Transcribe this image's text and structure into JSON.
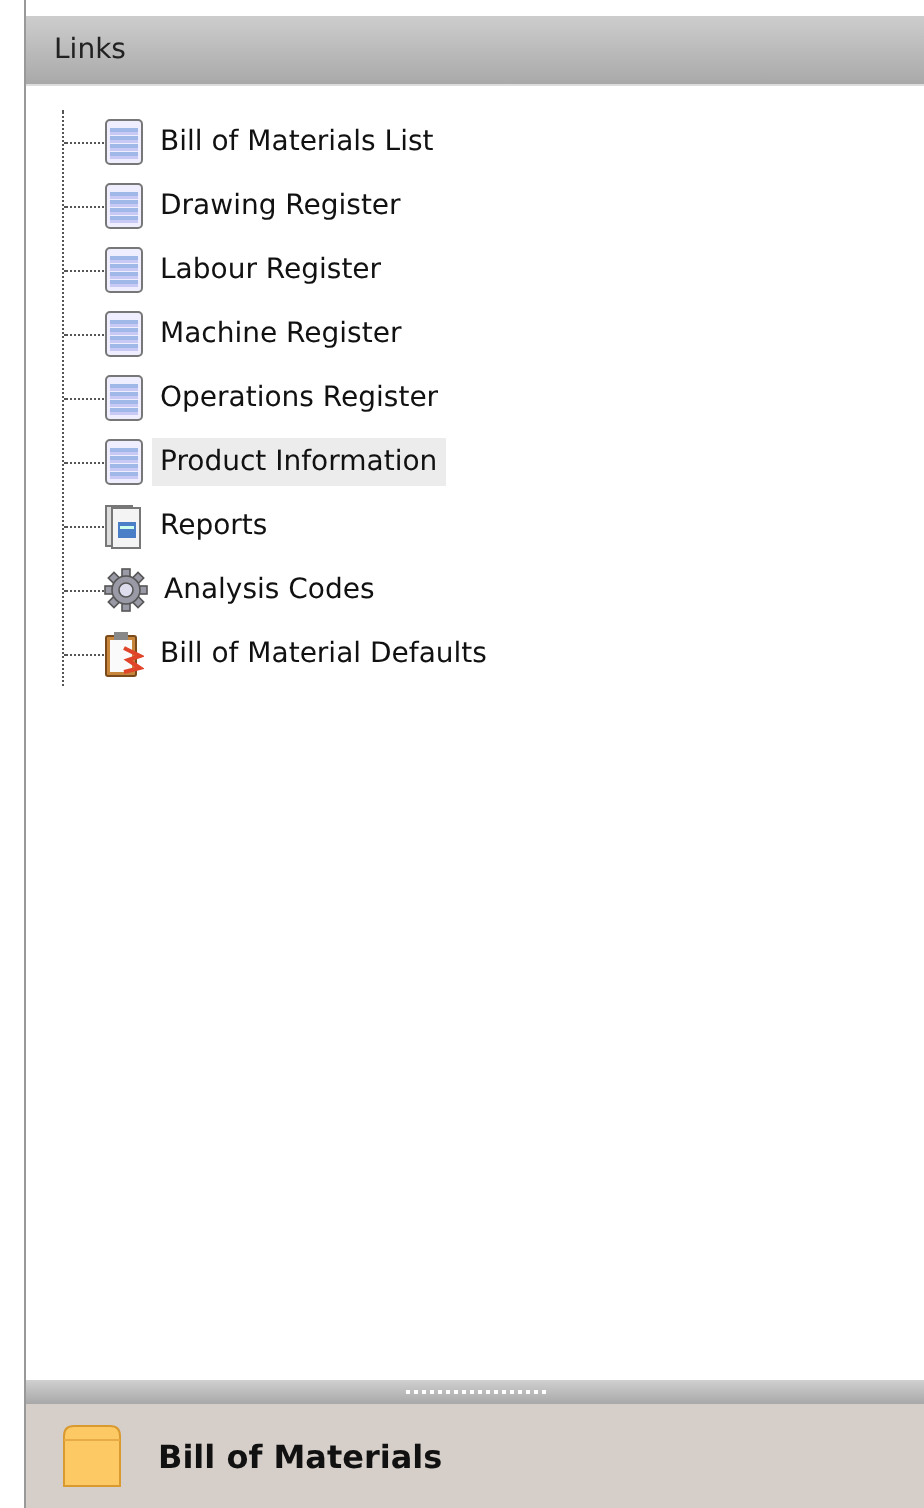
{
  "panel": {
    "title": "Links"
  },
  "tree": [
    {
      "label": "Bill of Materials List",
      "kind": "list",
      "selected": false
    },
    {
      "label": "Drawing Register",
      "kind": "list",
      "selected": false
    },
    {
      "label": "Labour Register",
      "kind": "list",
      "selected": false
    },
    {
      "label": "Machine Register",
      "kind": "list",
      "selected": false
    },
    {
      "label": "Operations Register",
      "kind": "list",
      "selected": false
    },
    {
      "label": "Product Information",
      "kind": "list",
      "selected": true
    },
    {
      "label": "Reports",
      "kind": "reports",
      "selected": false
    },
    {
      "label": "Analysis Codes",
      "kind": "gear",
      "selected": false
    },
    {
      "label": "Bill of Material Defaults",
      "kind": "defaults",
      "selected": false
    }
  ],
  "module_bar": {
    "label": "Bill of Materials"
  }
}
